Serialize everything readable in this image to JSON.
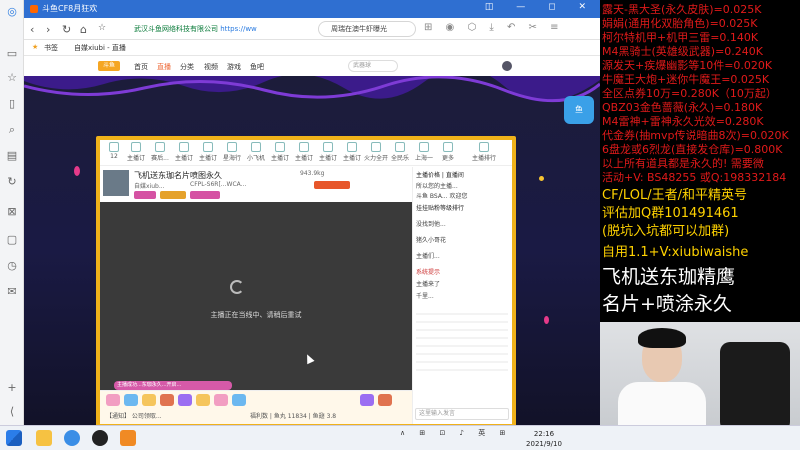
{
  "browser": {
    "tab_title": "斗鱼CF8月狂欢",
    "window_controls": "◫ — ◻ ✕",
    "url_site": "武汉斗鱼网络科技有限公司",
    "url": "https://ww",
    "search_text": "周瑞在澳牛虾曝光",
    "bookmarks_label": "书签",
    "bookmark_item": "自媒xiubi - 直播"
  },
  "douyu_header": {
    "logo": "斗鱼",
    "nav": [
      "首页",
      "直播",
      "分类",
      "视频",
      "游戏",
      "鱼吧"
    ],
    "active": "直播",
    "search_placeholder": "武器球"
  },
  "room": {
    "title": "飞机送东珈名片喷图永久",
    "streamer": "自媒xiub...",
    "channel": "CFPL-S6R[...WCA...",
    "fans": "943.9kg",
    "offline_msg": "主播正在当线中、请稍后重试",
    "gift_banner": "主播成功...东珈永久...开启...",
    "gift_text_left": "【通知】 公司领取...",
    "gift_text_right": "福利数 | 鱼丸 11834 | 鱼翅 3.8",
    "top_icons": [
      "12",
      "主播订",
      "赛后...",
      "主播订",
      "主播订",
      "星海行",
      "小飞机",
      "主播订",
      "主播订",
      "主播订",
      "主播订",
      "火力全开",
      "全民乐",
      "上海一",
      "更多",
      "主播排行"
    ]
  },
  "chat": {
    "header": "主播价格 | 直播间",
    "lines": [
      "所以您的主播...",
      "斗鱼 BSA... 欢迎您",
      "挂挂贴粉等级排行",
      "没找到他...",
      "猪久小哥花",
      "主播们...",
      "系统提示",
      "主播来了",
      "千里..."
    ],
    "input_placeholder": "这里输入发言"
  },
  "overlay": {
    "lines": [
      "露天-黑大圣(永久皮肤)=0.025K",
      "娟娟(通用化双胎角色)=0.025K",
      "柯尔特机甲+机甲三雷=0.140K",
      "M4黑骑士(英雄级武器)=0.240K",
      "源发天+疾爆幽影等10件=0.020K",
      "牛魔王大炮+迷你牛魔王=0.025K",
      "全区点券10万=0.280K（10万起）",
      "QBZ03金色蔷薇(永久)=0.180K",
      "M4雷神+雷神永久光效=0.280K",
      "代金券(抽mvp传说暗曲8次)=0.020K",
      "6盘龙或6烈龙(直接发仓库)=0.800K",
      "以上所有道具都是永久的! 需要微",
      "活动+V: BS48255   或Q:198332184"
    ],
    "yellow_lines": [
      "CF/LOL/王者/和平精英号",
      "评估加Q群101491461",
      "(脱坑入坑都可以加群)",
      "自用1.1+V:xiubiwaishe"
    ],
    "big_lines": [
      "飞机送东珈精鹰",
      "名片+喷涂永久"
    ]
  },
  "taskbar": {
    "tray": "∧ ⊞ ⊡ ♪ 英 ⊞",
    "time": "22:16",
    "date": "2021/9/10"
  },
  "colors": {
    "tab_blue": "#2f6fd1",
    "frame_gold": "#f0b21a",
    "overlay_red": "#e01a1a",
    "overlay_yellow": "#ffd200"
  }
}
